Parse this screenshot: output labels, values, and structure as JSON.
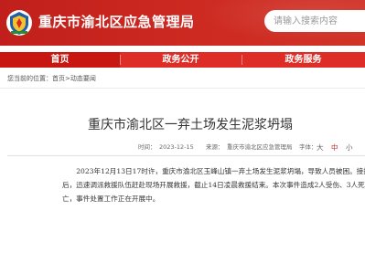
{
  "header": {
    "site_title": "重庆市渝北区应急管理局",
    "search_placeholder": "请输入搜索内容"
  },
  "nav": {
    "items": [
      {
        "label": "首页",
        "active": true
      },
      {
        "label": "政务公开",
        "active": false
      },
      {
        "label": "政务服务",
        "active": false
      }
    ]
  },
  "breadcrumb": {
    "prefix": "您当前的位置：",
    "home": "首页",
    "separator": ">",
    "current": "动态要闻"
  },
  "article": {
    "title": "重庆市渝北区一弃土场发生泥浆坍塌",
    "date_label": "时间：",
    "date": "2023-12-15",
    "source_label": "来源：",
    "source": "重庆市渝北区应急管理局",
    "font_label": "字体：",
    "font_sizes": [
      "大",
      "中",
      "小"
    ],
    "body": "2023年12月13日17时许，重庆市渝北区玉峰山镇一弃土场发生泥浆坍塌，导致人员被困。接报后，迅速调派救援队伍赶赴现场开展救援，截止14日凌晨救援结束。本次事件造成2人受伤、3人死亡，事件处置工作正在开展中。"
  },
  "colors": {
    "header_red": "#c8231e",
    "nav_red": "#dd2d26",
    "nav_active": "#c81710"
  }
}
